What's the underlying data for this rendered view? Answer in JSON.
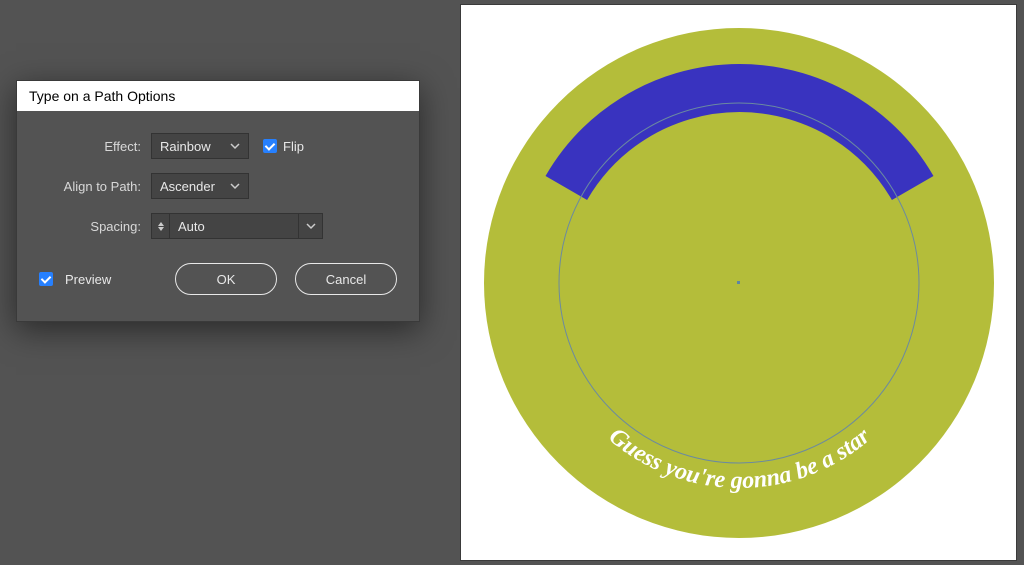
{
  "dialog": {
    "title": "Type on a Path Options",
    "labels": {
      "effect": "Effect:",
      "align": "Align to Path:",
      "spacing": "Spacing:",
      "flip": "Flip",
      "preview": "Preview"
    },
    "values": {
      "effect": "Rainbow",
      "align": "Ascender",
      "spacing": "Auto"
    },
    "buttons": {
      "ok": "OK",
      "cancel": "Cancel"
    },
    "flip_checked": true,
    "preview_checked": true
  },
  "artwork": {
    "curved_text": "Guess you're gonna be a star",
    "disc_color": "#b4bd3a",
    "arc_color": "#3933bf",
    "text_color": "#ffffff"
  }
}
